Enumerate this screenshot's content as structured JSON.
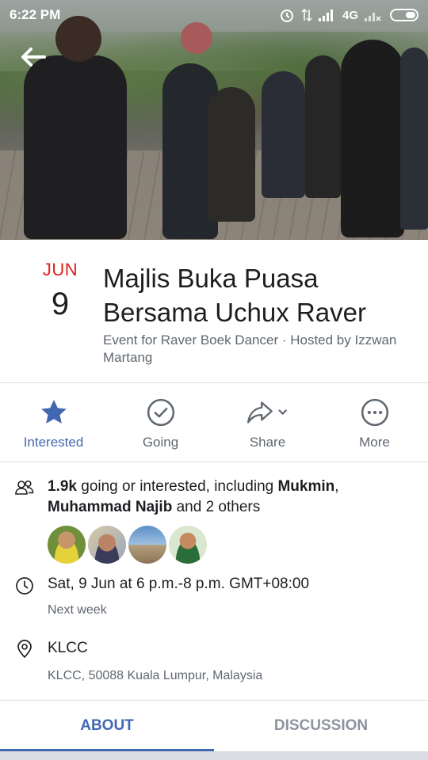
{
  "status_bar": {
    "time": "6:22 PM",
    "network": "4G"
  },
  "event": {
    "month": "JUN",
    "day": "9",
    "title": "Majlis Buka Puasa Bersama Uchux Raver",
    "subtitle": "Event for Raver Boek Dancer · Hosted by Izzwan Martang"
  },
  "actions": [
    {
      "label": "Interested",
      "icon": "star-icon",
      "active": true
    },
    {
      "label": "Going",
      "icon": "check-circle-icon",
      "active": false
    },
    {
      "label": "Share",
      "icon": "share-arrow-icon",
      "active": false
    },
    {
      "label": "More",
      "icon": "more-dots-icon",
      "active": false
    }
  ],
  "going": {
    "count": "1.9k",
    "text_1": " going or interested, including ",
    "name_1": "Mukmin",
    "sep": ", ",
    "name_2": "Muhammad Najib",
    "text_2": " and 2 others"
  },
  "time": {
    "main": "Sat, 9 Jun at 6 p.m.-8 p.m. GMT+08:00",
    "sub": "Next week"
  },
  "location": {
    "name": "KLCC",
    "address": "KLCC, 50088 Kuala Lumpur, Malaysia"
  },
  "tabs": [
    {
      "label": "ABOUT",
      "active": true
    },
    {
      "label": "DISCUSSION",
      "active": false
    }
  ],
  "colors": {
    "accent": "#4267b2",
    "date_month": "#e02020",
    "secondary_text": "#606770"
  }
}
